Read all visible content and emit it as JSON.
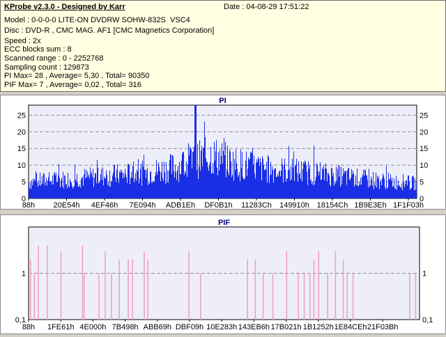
{
  "info": {
    "title": "KProbe v2.3.0 - Designed by Karr",
    "date": "Date : 04-08-29 17:51:22",
    "lines": [
      "Model : 0-0-0-0 LITE-ON DVDRW SOHW-832S  VSC4",
      "Disc : DVD-R , CMC MAG. AF1 [CMC Magnetics Corporation]",
      "Speed : 2x",
      "ECC blocks sum : 8",
      "Scanned range : 0 - 2252768",
      "Sampling count : 129873",
      "PI Max= 28 , Average= 5,30 , Total= 90350",
      "PIF Max= 7 , Average= 0,02 , Total= 316"
    ]
  },
  "chart_data": [
    {
      "type": "bar",
      "title": "PI",
      "x_tick_labels": [
        "88h",
        "20E54h",
        "4EF46h",
        "7E094h",
        "ADB1Eh",
        "DF0B1h",
        "11283Ch",
        "149910h",
        "18154Ch",
        "1B9E3Eh",
        "1F1F03h"
      ],
      "y_ticks": [
        0,
        5,
        10,
        15,
        20,
        25
      ],
      "ylim": [
        0,
        28
      ],
      "grid": true,
      "color": "#1a2ee6",
      "max": 28,
      "average": 5.3,
      "profile": [
        {
          "x": 0.0,
          "y": 5.5
        },
        {
          "x": 0.1,
          "y": 6.5
        },
        {
          "x": 0.2,
          "y": 7.5
        },
        {
          "x": 0.3,
          "y": 8.5
        },
        {
          "x": 0.38,
          "y": 10.5
        },
        {
          "x": 0.44,
          "y": 13.0
        },
        {
          "x": 0.47,
          "y": 14.5
        },
        {
          "x": 0.52,
          "y": 12.0
        },
        {
          "x": 0.6,
          "y": 10.0
        },
        {
          "x": 0.7,
          "y": 9.0
        },
        {
          "x": 0.8,
          "y": 7.5
        },
        {
          "x": 0.9,
          "y": 6.0
        },
        {
          "x": 1.0,
          "y": 5.0
        }
      ]
    },
    {
      "type": "bar",
      "title": "PIF",
      "x_tick_labels": [
        "88h",
        "1FE61h",
        "4E000h",
        "7B498h",
        "ABB69h",
        "DBF09h",
        "10E283h",
        "143EB6h",
        "17B021h",
        "1B1252h",
        "1E84CEh",
        "21F03Bh"
      ],
      "y_ticks": [
        0.1,
        1
      ],
      "y_tick_labels": [
        "0,1",
        "1"
      ],
      "y_scale": "log",
      "ylim": [
        0.1,
        10
      ],
      "grid": true,
      "color": "#f0a0c8",
      "max": 7,
      "average": 0.02,
      "spikes": [
        {
          "x": 0.005,
          "v": 2
        },
        {
          "x": 0.015,
          "v": 1
        },
        {
          "x": 0.025,
          "v": 4
        },
        {
          "x": 0.048,
          "v": 4
        },
        {
          "x": 0.083,
          "v": 3
        },
        {
          "x": 0.138,
          "v": 4
        },
        {
          "x": 0.142,
          "v": 1
        },
        {
          "x": 0.18,
          "v": 1
        },
        {
          "x": 0.196,
          "v": 3
        },
        {
          "x": 0.212,
          "v": 1
        },
        {
          "x": 0.232,
          "v": 2
        },
        {
          "x": 0.255,
          "v": 2
        },
        {
          "x": 0.266,
          "v": 2
        },
        {
          "x": 0.296,
          "v": 3
        },
        {
          "x": 0.305,
          "v": 2
        },
        {
          "x": 0.41,
          "v": 3
        },
        {
          "x": 0.44,
          "v": 1
        },
        {
          "x": 0.56,
          "v": 2
        },
        {
          "x": 0.58,
          "v": 2
        },
        {
          "x": 0.6,
          "v": 1
        },
        {
          "x": 0.625,
          "v": 1
        },
        {
          "x": 0.66,
          "v": 3
        },
        {
          "x": 0.69,
          "v": 1
        },
        {
          "x": 0.705,
          "v": 1
        },
        {
          "x": 0.72,
          "v": 1
        },
        {
          "x": 0.73,
          "v": 2
        },
        {
          "x": 0.742,
          "v": 3
        },
        {
          "x": 0.765,
          "v": 1
        },
        {
          "x": 0.785,
          "v": 3
        },
        {
          "x": 0.805,
          "v": 2
        },
        {
          "x": 0.815,
          "v": 1
        },
        {
          "x": 0.83,
          "v": 1
        },
        {
          "x": 0.975,
          "v": 1
        },
        {
          "x": 0.99,
          "v": 1
        }
      ]
    }
  ]
}
